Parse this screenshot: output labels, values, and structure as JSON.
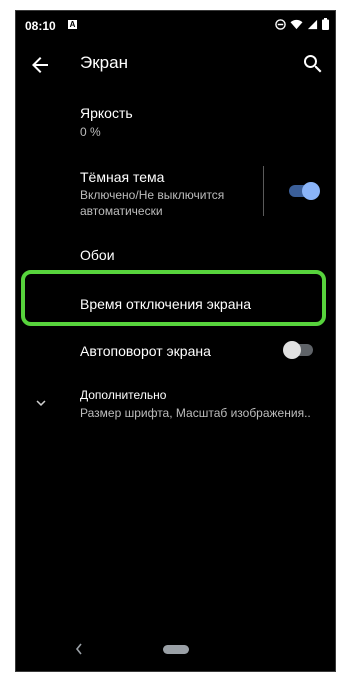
{
  "status_bar": {
    "time": "08:10",
    "notification_letter": "A",
    "icons": [
      "dnd-icon",
      "wifi-icon",
      "signal-icon",
      "battery-icon"
    ]
  },
  "app_bar": {
    "title": "Экран",
    "back_icon": "arrow-back-icon",
    "search_icon": "search-icon"
  },
  "settings": {
    "brightness": {
      "title": "Яркость",
      "subtitle": "0 %"
    },
    "dark_theme": {
      "title": "Тёмная тема",
      "subtitle_line1": "Включено/Не выключится",
      "subtitle_line2": "автоматически",
      "enabled": true
    },
    "wallpaper": {
      "title": "Обои"
    },
    "screen_timeout": {
      "title": "Время отключения экрана"
    },
    "auto_rotate": {
      "title": "Автоповорот экрана",
      "enabled": false
    },
    "advanced": {
      "title": "Дополнительно",
      "subtitle": "Размер шрифта, Масштаб изображения..",
      "icon": "chevron-down-icon"
    }
  },
  "colors": {
    "background": "#000000",
    "accent": "#8ab4f8",
    "highlight": "#57d33c"
  }
}
